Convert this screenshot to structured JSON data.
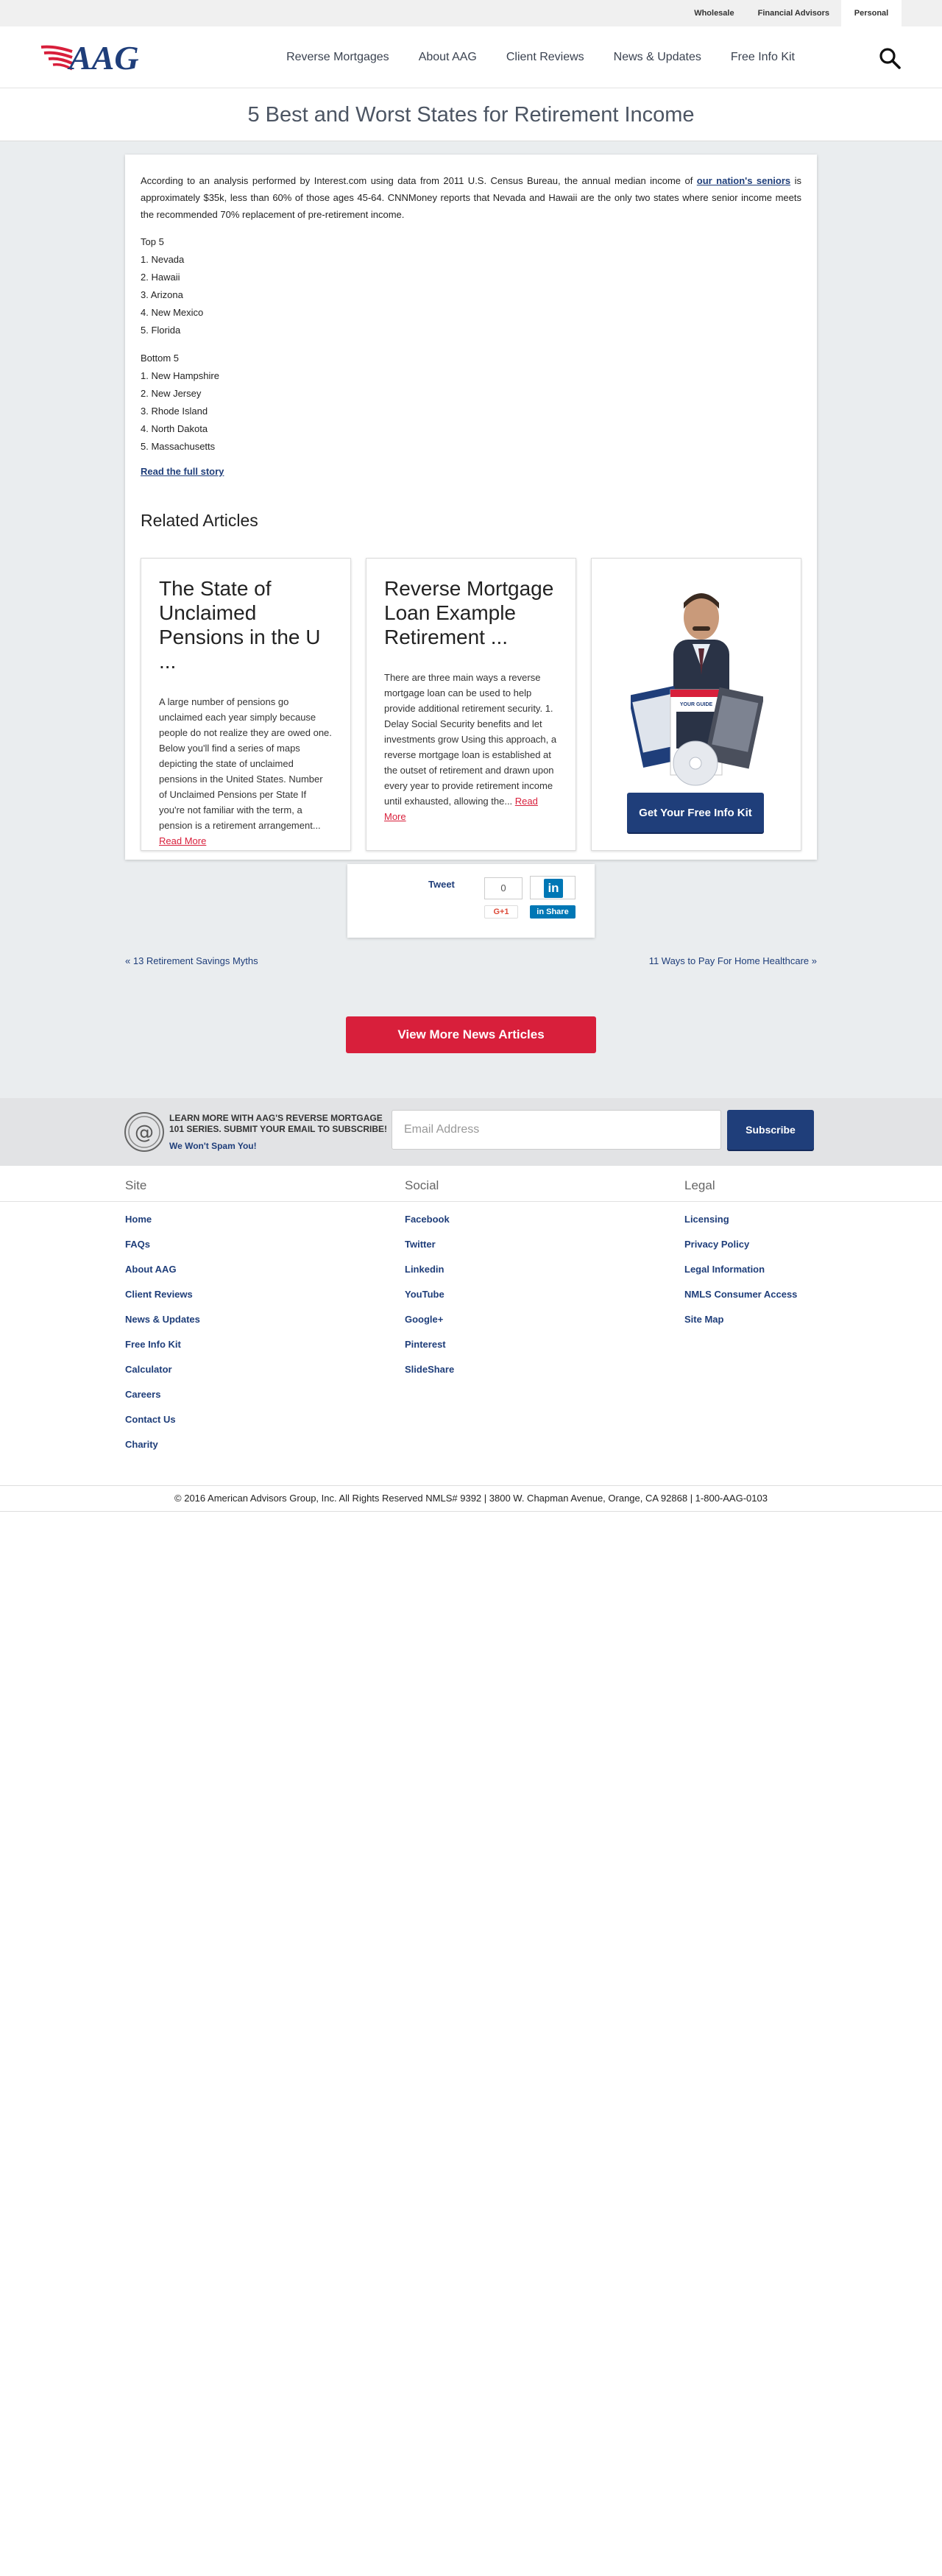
{
  "utility_nav": {
    "items": [
      {
        "label": "Wholesale"
      },
      {
        "label": "Financial Advisors"
      },
      {
        "label": "Personal"
      }
    ]
  },
  "header": {
    "logo_text": "AAG",
    "nav": [
      {
        "label": "Reverse Mortgages"
      },
      {
        "label": "About AAG"
      },
      {
        "label": "Client Reviews"
      },
      {
        "label": "News & Updates"
      },
      {
        "label": "Free Info Kit"
      }
    ],
    "search_icon": "search-icon"
  },
  "page_title": "5 Best and Worst States for Retirement Income",
  "article": {
    "intro_before_link": "According to an analysis performed by Interest.com using data from 2011 U.S. Census Bureau, the annual median income of ",
    "intro_link": "our nation's seniors",
    "intro_after_link": " is approximately $35k, less than 60% of those ages 45-64. CNNMoney reports that Nevada and Hawaii are the only two states where senior income meets the recommended 70% replacement of pre-retirement income.",
    "top_heading": "Top 5",
    "top": [
      "1. Nevada",
      "2. Hawaii",
      "3. Arizona",
      "4. New Mexico",
      "5. Florida"
    ],
    "bottom_heading": "Bottom 5",
    "bottom": [
      "1. New Hampshire",
      "2. New Jersey",
      "3. Rhode Island",
      "4. North Dakota",
      "5. Massachusetts"
    ],
    "read_full": "Read the full story"
  },
  "related": {
    "heading": "Related Articles",
    "cards": [
      {
        "title": "The State of Unclaimed Pensions in the U ...",
        "excerpt": "A large number of pensions go unclaimed each year simply because people do not realize they are owed one. Below you'll find a series of maps depicting the state of unclaimed pensions in the United States. Number of Unclaimed Pensions per State If you're not familiar with the term, a pension is a retirement arrangement...",
        "read_more": "Read More"
      },
      {
        "title": "Reverse Mortgage Loan Example Retirement ...",
        "excerpt": "There are three main ways a reverse mortgage loan can be used to help provide additional retirement security.   1. Delay Social Security benefits and let investments grow Using this approach, a reverse mortgage loan is established at the outset of retirement and drawn upon every year to provide retirement income until exhausted, allowing the...",
        "read_more": "Read More"
      }
    ],
    "kit_button": "Get Your Free Info Kit",
    "kit_box_label": "YOUR GUIDE"
  },
  "share": {
    "tweet": "Tweet",
    "count": "0",
    "gplus": "G+1",
    "linkedin_share": "Share",
    "linkedin_logo": "in"
  },
  "pager": {
    "prev": "« 13 Retirement Savings Myths",
    "next": "11 Ways to Pay For Home Healthcare »"
  },
  "view_more": "View More News Articles",
  "newsletter": {
    "text": "LEARN MORE WITH AAG'S REVERSE MORTGAGE 101 SERIES. SUBMIT YOUR EMAIL TO SUBSCRIBE!",
    "spam": "We Won't Spam You!",
    "placeholder": "Email Address",
    "button": "Subscribe"
  },
  "footer": {
    "site": {
      "heading": "Site",
      "links": [
        "Home",
        "FAQs",
        "About AAG",
        "Client Reviews",
        "News & Updates",
        "Free Info Kit",
        "Calculator",
        "Careers",
        "Contact Us",
        "Charity"
      ]
    },
    "social": {
      "heading": "Social",
      "links": [
        "Facebook",
        "Twitter",
        "Linkedin",
        "YouTube",
        "Google+",
        "Pinterest",
        "SlideShare"
      ]
    },
    "legal": {
      "heading": "Legal",
      "links": [
        "Licensing",
        "Privacy Policy",
        "Legal Information",
        "NMLS Consumer Access",
        "Site Map"
      ]
    },
    "copyright": "© 2016 American Advisors Group, Inc. All Rights Reserved NMLS# 9392 | 3800 W. Chapman Avenue, Orange, CA 92868 | 1-800-AAG-0103"
  },
  "colors": {
    "brand_navy": "#1f3e7a",
    "brand_red": "#d81f3b",
    "page_gray": "#eaedef"
  }
}
